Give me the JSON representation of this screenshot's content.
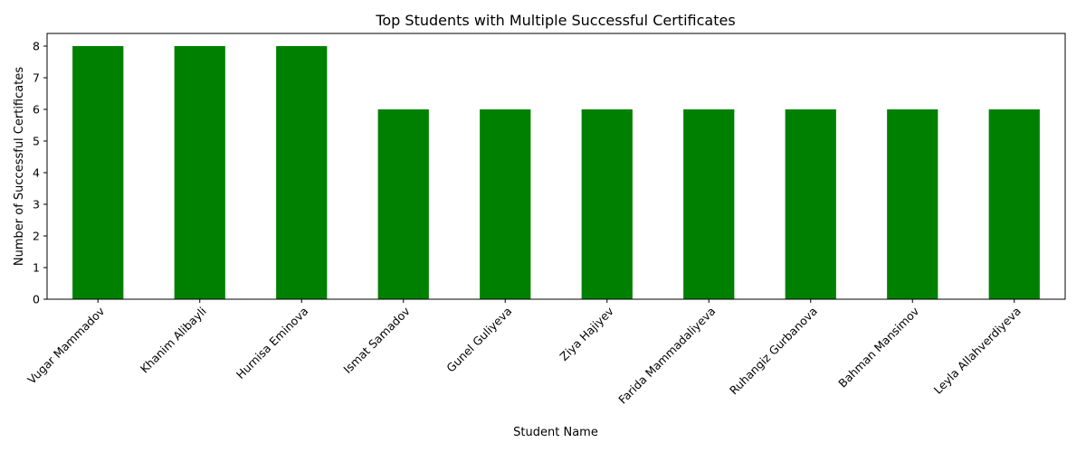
{
  "chart_data": {
    "type": "bar",
    "title": "Top Students with Multiple Successful Certificates",
    "xlabel": "Student Name",
    "ylabel": "Number of Successful Certificates",
    "categories": [
      "Vugar Mammadov",
      "Khanim Alibayli",
      "Hurnisa Eminova",
      "Ismat Samadov",
      "Gunel Guliyeva",
      "Ziya Hajiyev",
      "Farida Mammadaliyeva",
      "Ruhangiz Gurbanova",
      "Bahman Mansimov",
      "Leyla Allahverdiyeva"
    ],
    "values": [
      8,
      8,
      8,
      6,
      6,
      6,
      6,
      6,
      6,
      6
    ],
    "ylim": [
      0,
      8.4
    ],
    "yticks": [
      0,
      1,
      2,
      3,
      4,
      5,
      6,
      7,
      8
    ],
    "bar_color": "#008000",
    "grid": false,
    "legend": "none"
  }
}
